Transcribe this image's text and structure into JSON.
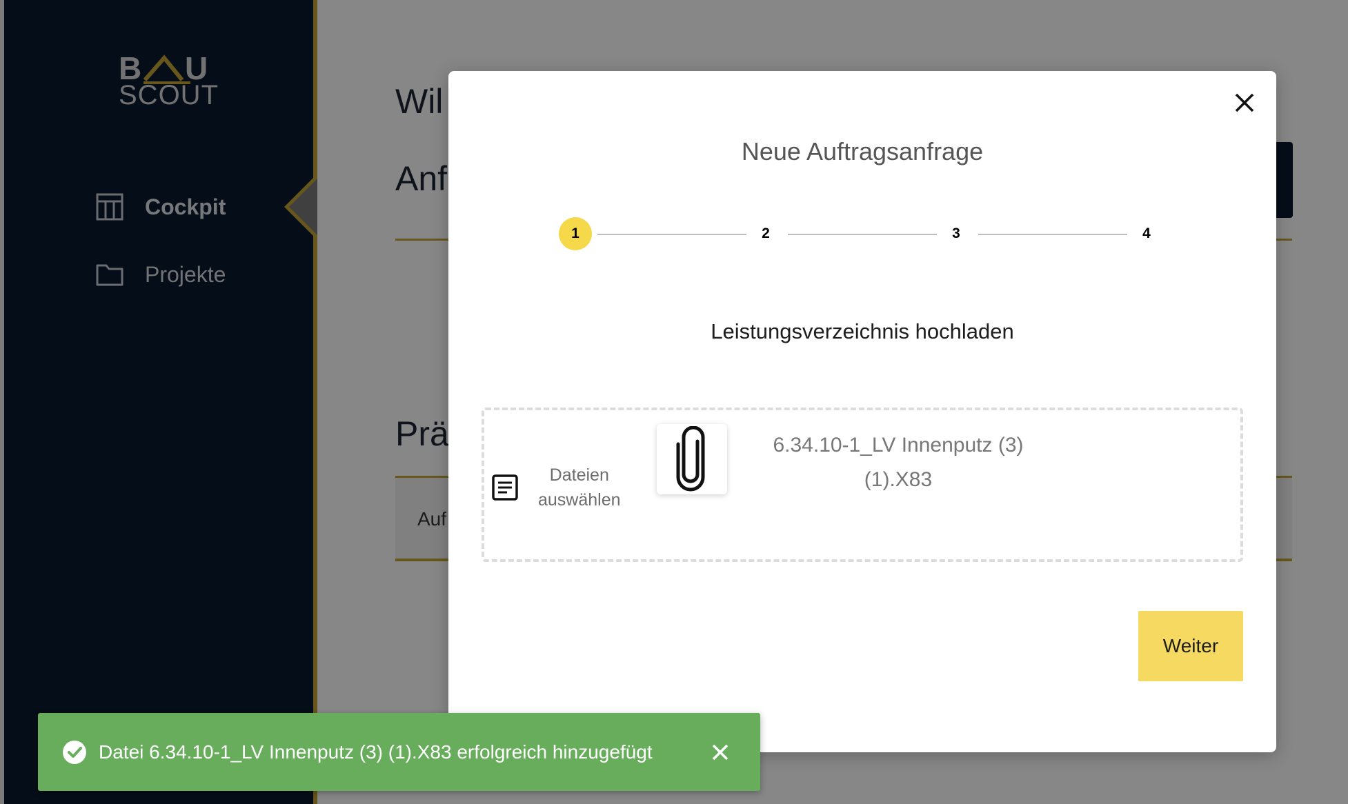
{
  "app": {
    "logo": {
      "top_left": "B",
      "top_right": "U",
      "bottom": "SCOUT"
    },
    "sidebar": {
      "items": [
        {
          "label": "Cockpit",
          "icon": "dashboard-icon",
          "active": true
        },
        {
          "label": "Projekte",
          "icon": "folder-icon",
          "active": false
        }
      ]
    },
    "main": {
      "heading1": "Wil",
      "heading2": "Anf",
      "heading3": "Prä",
      "table_header": "Auf"
    }
  },
  "modal": {
    "title": "Neue Auftragsanfrage",
    "close_icon": "close-icon",
    "steps": [
      "1",
      "2",
      "3",
      "4"
    ],
    "active_step": 1,
    "section_title": "Leistungsverzeichnis hochladen",
    "dropzone": {
      "select_label_line1": "Dateien",
      "select_label_line2": "auswählen",
      "file_name_line1": "6.34.10-1_LV Innenputz (3)",
      "file_name_line2": "(1).X83",
      "file_icon": "paperclip-icon"
    },
    "next_button": "Weiter"
  },
  "toast": {
    "message": "Datei 6.34.10-1_LV Innenputz (3) (1).X83 erfolgreich hinzugefügt",
    "status": "success",
    "color": "#67ad5b"
  },
  "colors": {
    "sidebar_bg": "#0b1a2e",
    "accent_gold": "#c2a537",
    "active_step": "#f5d94a",
    "button_yellow": "#f5d960"
  }
}
